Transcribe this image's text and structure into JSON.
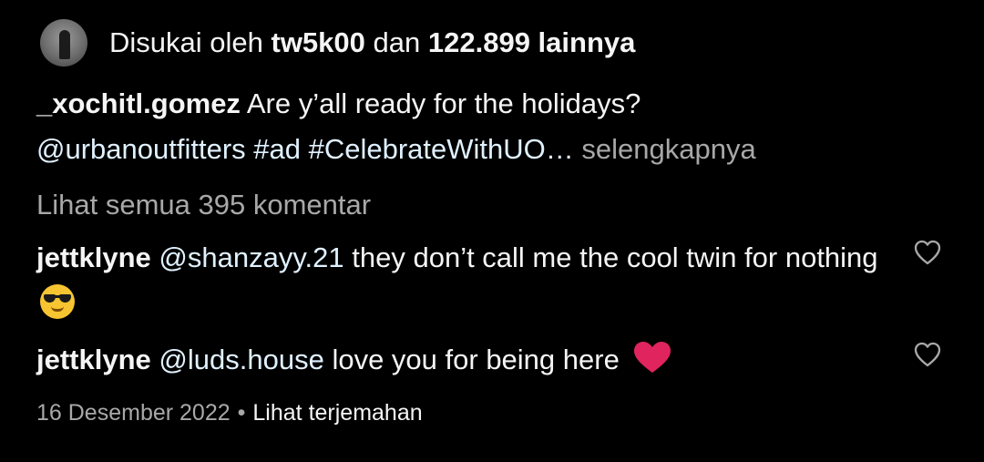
{
  "likes": {
    "prefix": "Disukai oleh",
    "user": "tw5k00",
    "conjunction": "dan",
    "count": "122.899 lainnya",
    "avatar_icon": "user-avatar"
  },
  "caption": {
    "username": "_xochitl.gomez",
    "text": "Are y’all ready for the holidays?",
    "mention": "@urbanoutfitters",
    "hashtag_ad": "#ad",
    "hashtag_uo": "#CelebrateWithUO…",
    "more_label": "selengkapnya"
  },
  "view_all_comments": "Lihat semua 395 komentar",
  "comments": [
    {
      "username": "jettklyne",
      "mention": "@shanzayy.21",
      "text": "they don’t call me the cool twin for nothing",
      "emoji": "smiling-face-with-sunglasses",
      "like_icon": "heart-outline-icon"
    },
    {
      "username": "jettklyne",
      "mention": "@luds.house",
      "text": "love you for being here",
      "emoji": "red-heart",
      "like_icon": "heart-outline-icon"
    }
  ],
  "footer": {
    "date": "16 Desember 2022",
    "separator": "•",
    "translate_label": "Lihat terjemahan"
  },
  "colors": {
    "background": "#000000",
    "text": "#f5f5f5",
    "muted": "#a8a8a8",
    "link": "#e0f1ff",
    "heart": "#e0245e",
    "emoji_yellow": "#f7c531"
  }
}
